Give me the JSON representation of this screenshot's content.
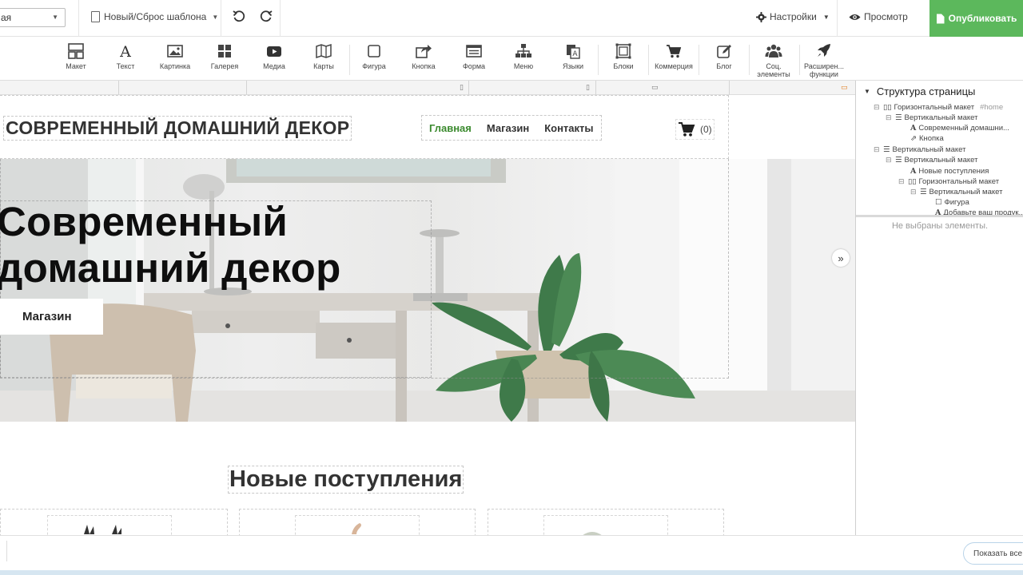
{
  "topbar": {
    "page_select_value": "ая",
    "template_label": "Новый/Сброс шаблона",
    "settings_label": "Настройки",
    "preview_label": "Просмотр",
    "publish_label": "Опубликовать",
    "publish_color": "#5cb85c"
  },
  "toolbar": {
    "tools": [
      "Макет",
      "Текст",
      "Картинка",
      "Галерея",
      "Медиа",
      "Карты",
      "Фигура",
      "Кнопка",
      "Форма",
      "Меню",
      "Языки",
      "Блоки",
      "Коммерция",
      "Блог"
    ],
    "social_line1": "Соц.",
    "social_line2": "элементы",
    "advanced_line1": "Расширен...",
    "advanced_line2": "функции"
  },
  "site": {
    "title": "СОВРЕМЕННЫЙ ДОМАШНИЙ ДЕКОР",
    "nav": [
      "Главная",
      "Магазин",
      "Контакты"
    ],
    "nav_active_color": "#3b8a2e",
    "cart_count": "(0)",
    "hero_line1": "Современный",
    "hero_line2": "домашний декор",
    "hero_button": "Магазин",
    "new_arrivals": "Новые поступления"
  },
  "panel": {
    "title": "Структура страницы",
    "tree": [
      {
        "label": "Горизонтальный макет",
        "tag": "#home"
      },
      {
        "label": "Вертикальный макет"
      },
      {
        "label": "Современный домашни..."
      },
      {
        "label": "Кнопка"
      },
      {
        "label": "Вертикальный макет"
      },
      {
        "label": "Вертикальный макет"
      },
      {
        "label": "Новые поступления"
      },
      {
        "label": "Горизонтальный макет"
      },
      {
        "label": "Вертикальный макет"
      },
      {
        "label": "Фигура"
      },
      {
        "label": "Добавьте ваш продук..."
      }
    ],
    "empty_text": "Не выбраны элементы."
  },
  "bottom": {
    "show_all": "Показать все"
  }
}
